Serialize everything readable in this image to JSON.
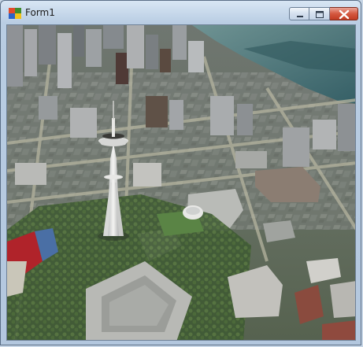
{
  "window": {
    "title": "Form1",
    "icon": "winforms-app-icon",
    "controls": [
      "minimize-icon",
      "maximize-icon",
      "close-icon"
    ]
  },
  "view": {
    "content": "3d-city-aerial-map",
    "landmark": "space-needle"
  },
  "colors": {
    "titlebar": "#c9dbee",
    "close_button": "#c94a31",
    "water": "#3f6f76"
  }
}
